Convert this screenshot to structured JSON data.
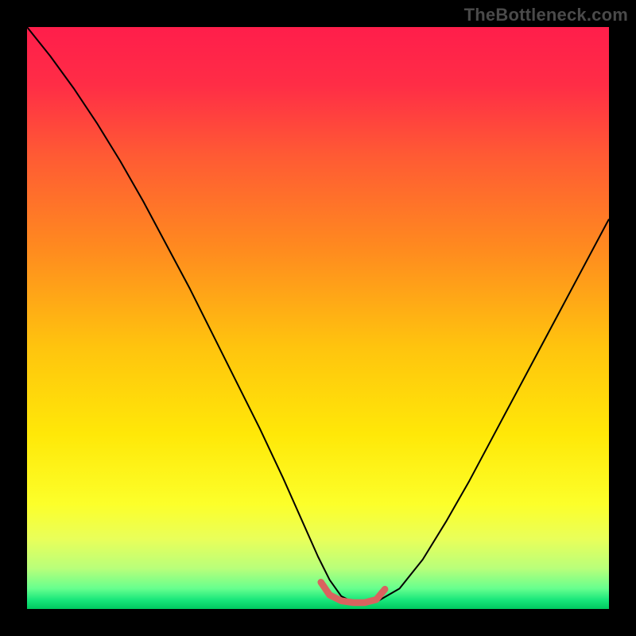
{
  "watermark": "TheBottleneck.com",
  "chart_data": {
    "type": "line",
    "title": "",
    "xlabel": "",
    "ylabel": "",
    "xlim": [
      0,
      100
    ],
    "ylim": [
      0,
      100
    ],
    "grid": false,
    "legend": false,
    "annotations": [],
    "gradient_stops": [
      {
        "offset": 0.0,
        "color": "#ff1e4b"
      },
      {
        "offset": 0.1,
        "color": "#ff2d46"
      },
      {
        "offset": 0.22,
        "color": "#ff5a34"
      },
      {
        "offset": 0.38,
        "color": "#ff8a1f"
      },
      {
        "offset": 0.55,
        "color": "#ffc40e"
      },
      {
        "offset": 0.7,
        "color": "#ffe808"
      },
      {
        "offset": 0.82,
        "color": "#fcff2a"
      },
      {
        "offset": 0.88,
        "color": "#e9ff5a"
      },
      {
        "offset": 0.93,
        "color": "#b9ff7a"
      },
      {
        "offset": 0.965,
        "color": "#66ff8e"
      },
      {
        "offset": 0.985,
        "color": "#17e67a"
      },
      {
        "offset": 1.0,
        "color": "#00c95f"
      }
    ],
    "series": [
      {
        "name": "bottleneck-curve",
        "color": "#000000",
        "stroke_width": 2.0,
        "x": [
          0,
          4,
          8,
          12,
          16,
          20,
          24,
          28,
          32,
          36,
          40,
          44,
          48,
          50,
          52,
          54,
          56,
          58,
          60,
          64,
          68,
          72,
          76,
          80,
          84,
          88,
          92,
          96,
          100
        ],
        "y": [
          100,
          95,
          89.5,
          83.5,
          77,
          70,
          62.5,
          55,
          47,
          39,
          31,
          22.5,
          13.5,
          9,
          5,
          2.2,
          1.2,
          1.0,
          1.2,
          3.5,
          8.5,
          15,
          22,
          29.5,
          37,
          44.5,
          52,
          59.5,
          67
        ]
      },
      {
        "name": "optimal-band",
        "color": "#d9635f",
        "stroke_width": 8.5,
        "linecap": "round",
        "x": [
          50.5,
          52,
          54,
          56,
          58,
          60,
          61.5
        ],
        "y": [
          4.6,
          2.4,
          1.4,
          1.1,
          1.1,
          1.6,
          3.4
        ]
      }
    ]
  }
}
